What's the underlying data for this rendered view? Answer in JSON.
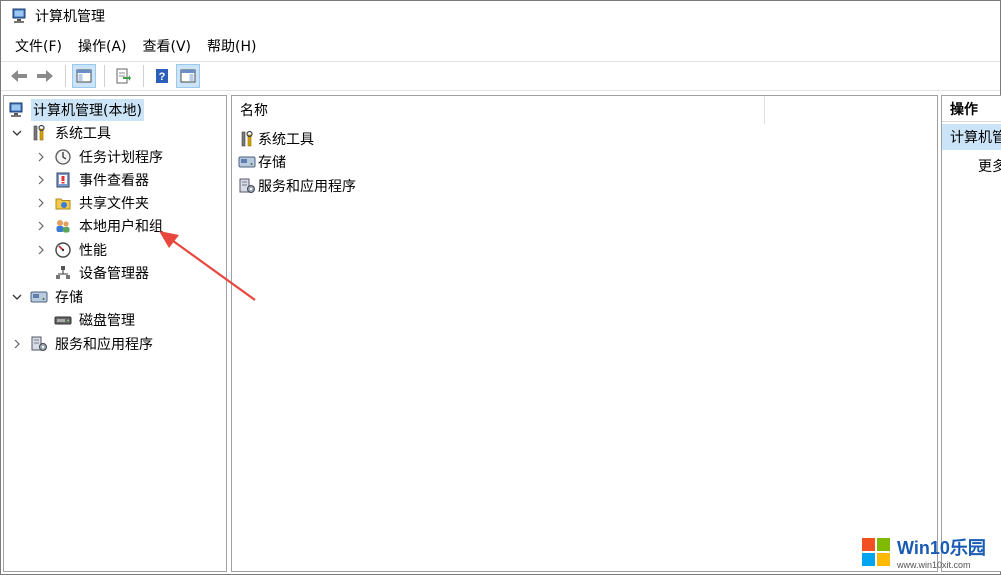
{
  "window": {
    "title": "计算机管理"
  },
  "menu": [
    {
      "label": "文件(F)"
    },
    {
      "label": "操作(A)"
    },
    {
      "label": "查看(V)"
    },
    {
      "label": "帮助(H)"
    }
  ],
  "toolbar": {
    "buttons": [
      {
        "icon": "back-arrow-icon"
      },
      {
        "icon": "forward-arrow-icon"
      },
      {
        "icon": "show-hide-console-tree-icon"
      },
      {
        "icon": "export-list-icon"
      },
      {
        "icon": "help-icon"
      },
      {
        "icon": "show-hide-action-pane-icon"
      }
    ]
  },
  "tree": {
    "root": "计算机管理(本地)",
    "system_tools": "系统工具",
    "task_scheduler": "任务计划程序",
    "event_viewer": "事件查看器",
    "shared_folders": "共享文件夹",
    "local_users": "本地用户和组",
    "performance": "性能",
    "device_manager": "设备管理器",
    "storage": "存储",
    "disk_management": "磁盘管理",
    "services_apps": "服务和应用程序"
  },
  "list": {
    "column_name": "名称",
    "items": [
      {
        "label": "系统工具",
        "icon": "tools-icon"
      },
      {
        "label": "存储",
        "icon": "storage-icon"
      },
      {
        "label": "服务和应用程序",
        "icon": "services-icon"
      }
    ]
  },
  "actions": {
    "header": "操作",
    "selected": "计算机管",
    "more": "更多"
  },
  "watermark": {
    "brand": "Win10乐园",
    "url": "www.win10xit.com"
  },
  "colors": {
    "selection": "#cce4f7",
    "annotation_arrow": "#e8473d",
    "brand_blue": "#1a5bb5"
  }
}
